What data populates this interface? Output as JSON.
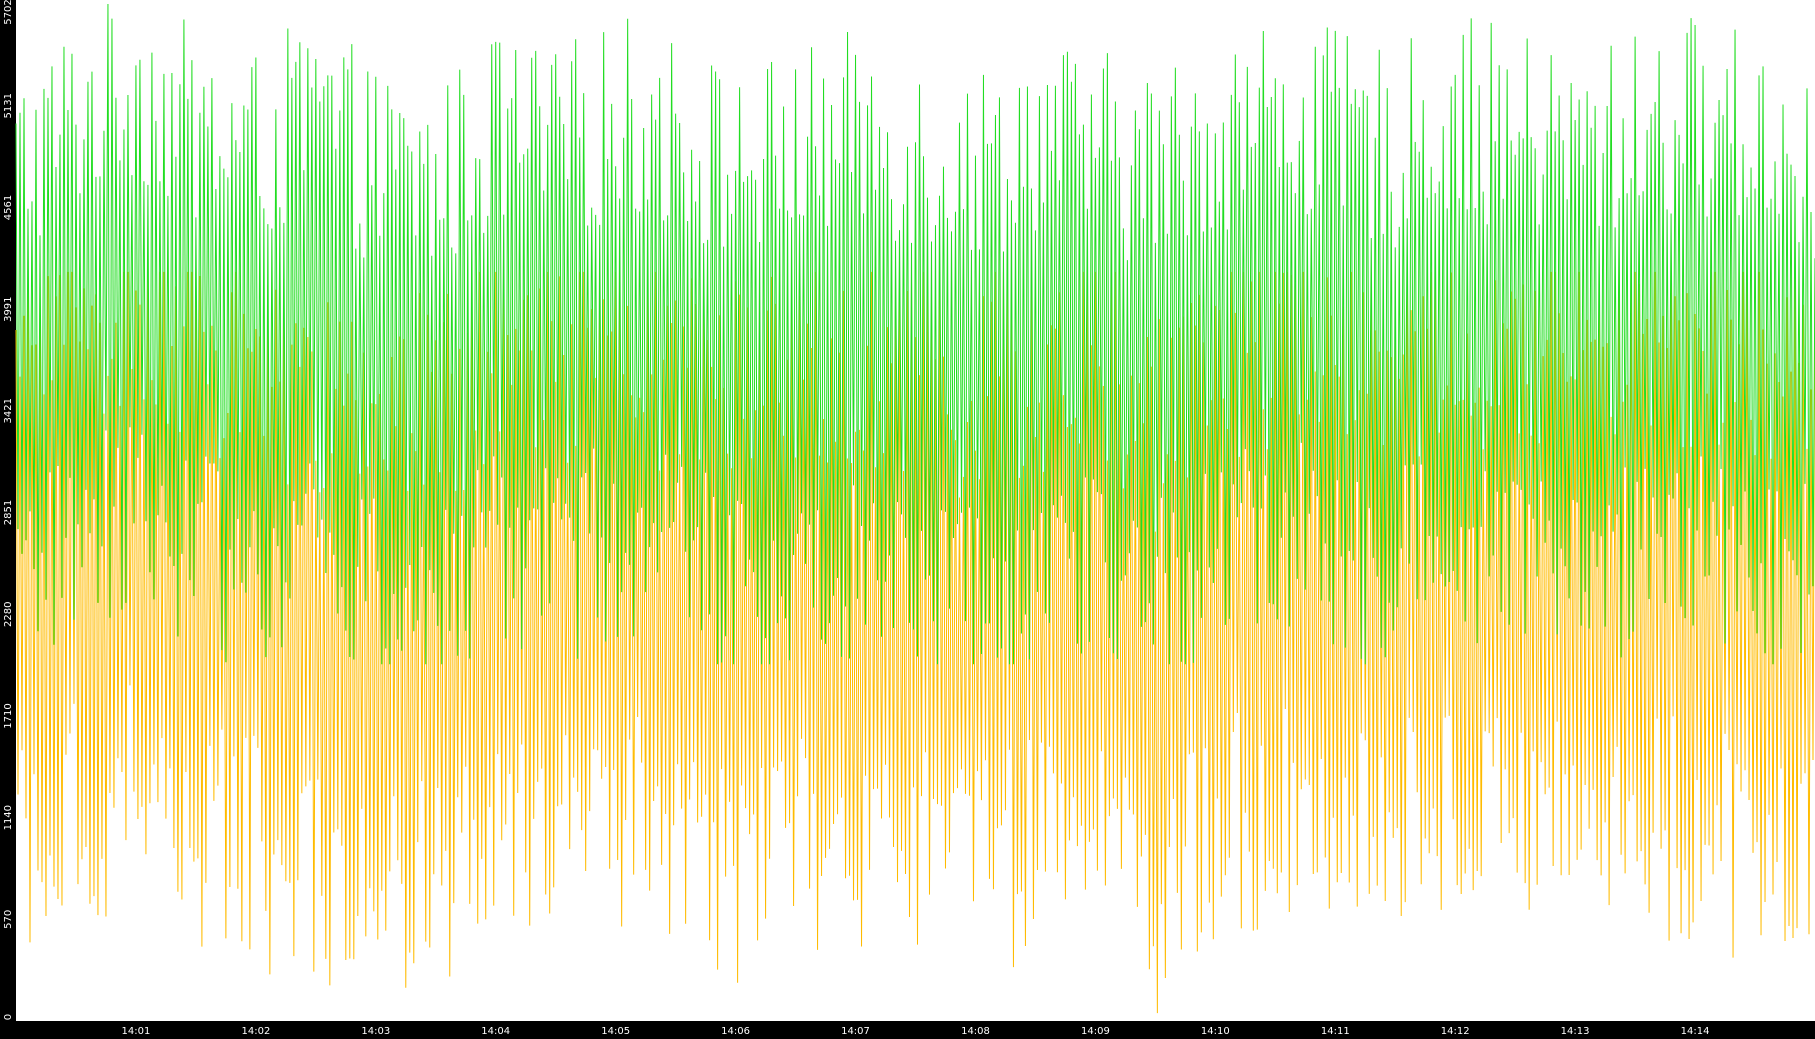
{
  "chart_data": {
    "type": "line",
    "title": "",
    "xlabel": "",
    "ylabel": "",
    "ylim": [
      0,
      5702
    ],
    "y_ticks": [
      0,
      570,
      1140,
      1710,
      2280,
      2851,
      3421,
      3991,
      4561,
      5131,
      5702
    ],
    "x_ticks": [
      "14:01",
      "14:02",
      "14:03",
      "14:04",
      "14:05",
      "14:06",
      "14:07",
      "14:08",
      "14:09",
      "14:10",
      "14:11",
      "14:12",
      "14:13",
      "14:14"
    ],
    "x_range_minutes": [
      0,
      15
    ],
    "grid": false,
    "legend": "none",
    "series": [
      {
        "color": "#22dd22",
        "approx_range": [
          2000,
          5702
        ],
        "approx_mean": 3700,
        "x": [
          0.0,
          0.5,
          1.0,
          1.5,
          2.0,
          2.5,
          3.0,
          3.5,
          4.0,
          4.5,
          5.0,
          5.5,
          6.0,
          6.5,
          7.0,
          7.5,
          8.0,
          8.5,
          9.0,
          9.5,
          10.0,
          10.5,
          11.0,
          11.5,
          12.0,
          12.5,
          13.0,
          13.5,
          14.0,
          14.5,
          15.0
        ],
        "values": [
          3600,
          3900,
          4100,
          3800,
          3700,
          3900,
          3600,
          3500,
          3800,
          3700,
          3900,
          3800,
          3600,
          3700,
          3800,
          3700,
          3600,
          3800,
          3700,
          3600,
          3800,
          3900,
          3800,
          3700,
          3900,
          3800,
          3700,
          3800,
          3900,
          3800,
          3600
        ]
      },
      {
        "color": "#ffbb00",
        "approx_range": [
          0,
          4200
        ],
        "approx_mean": 2300,
        "x": [
          0.0,
          0.5,
          1.0,
          1.5,
          2.0,
          2.5,
          3.0,
          3.5,
          4.0,
          4.5,
          5.0,
          5.5,
          6.0,
          6.5,
          7.0,
          7.5,
          8.0,
          8.5,
          9.0,
          9.5,
          10.0,
          10.5,
          11.0,
          11.5,
          12.0,
          12.5,
          13.0,
          13.5,
          14.0,
          14.5,
          15.0
        ],
        "values": [
          2200,
          2500,
          2600,
          2400,
          2300,
          2100,
          1900,
          2200,
          2300,
          2400,
          2500,
          2300,
          2200,
          2300,
          2400,
          2300,
          2200,
          2300,
          2400,
          2000,
          2400,
          2500,
          2600,
          2500,
          2400,
          2500,
          2600,
          2500,
          2400,
          2300,
          2300
        ]
      }
    ]
  }
}
